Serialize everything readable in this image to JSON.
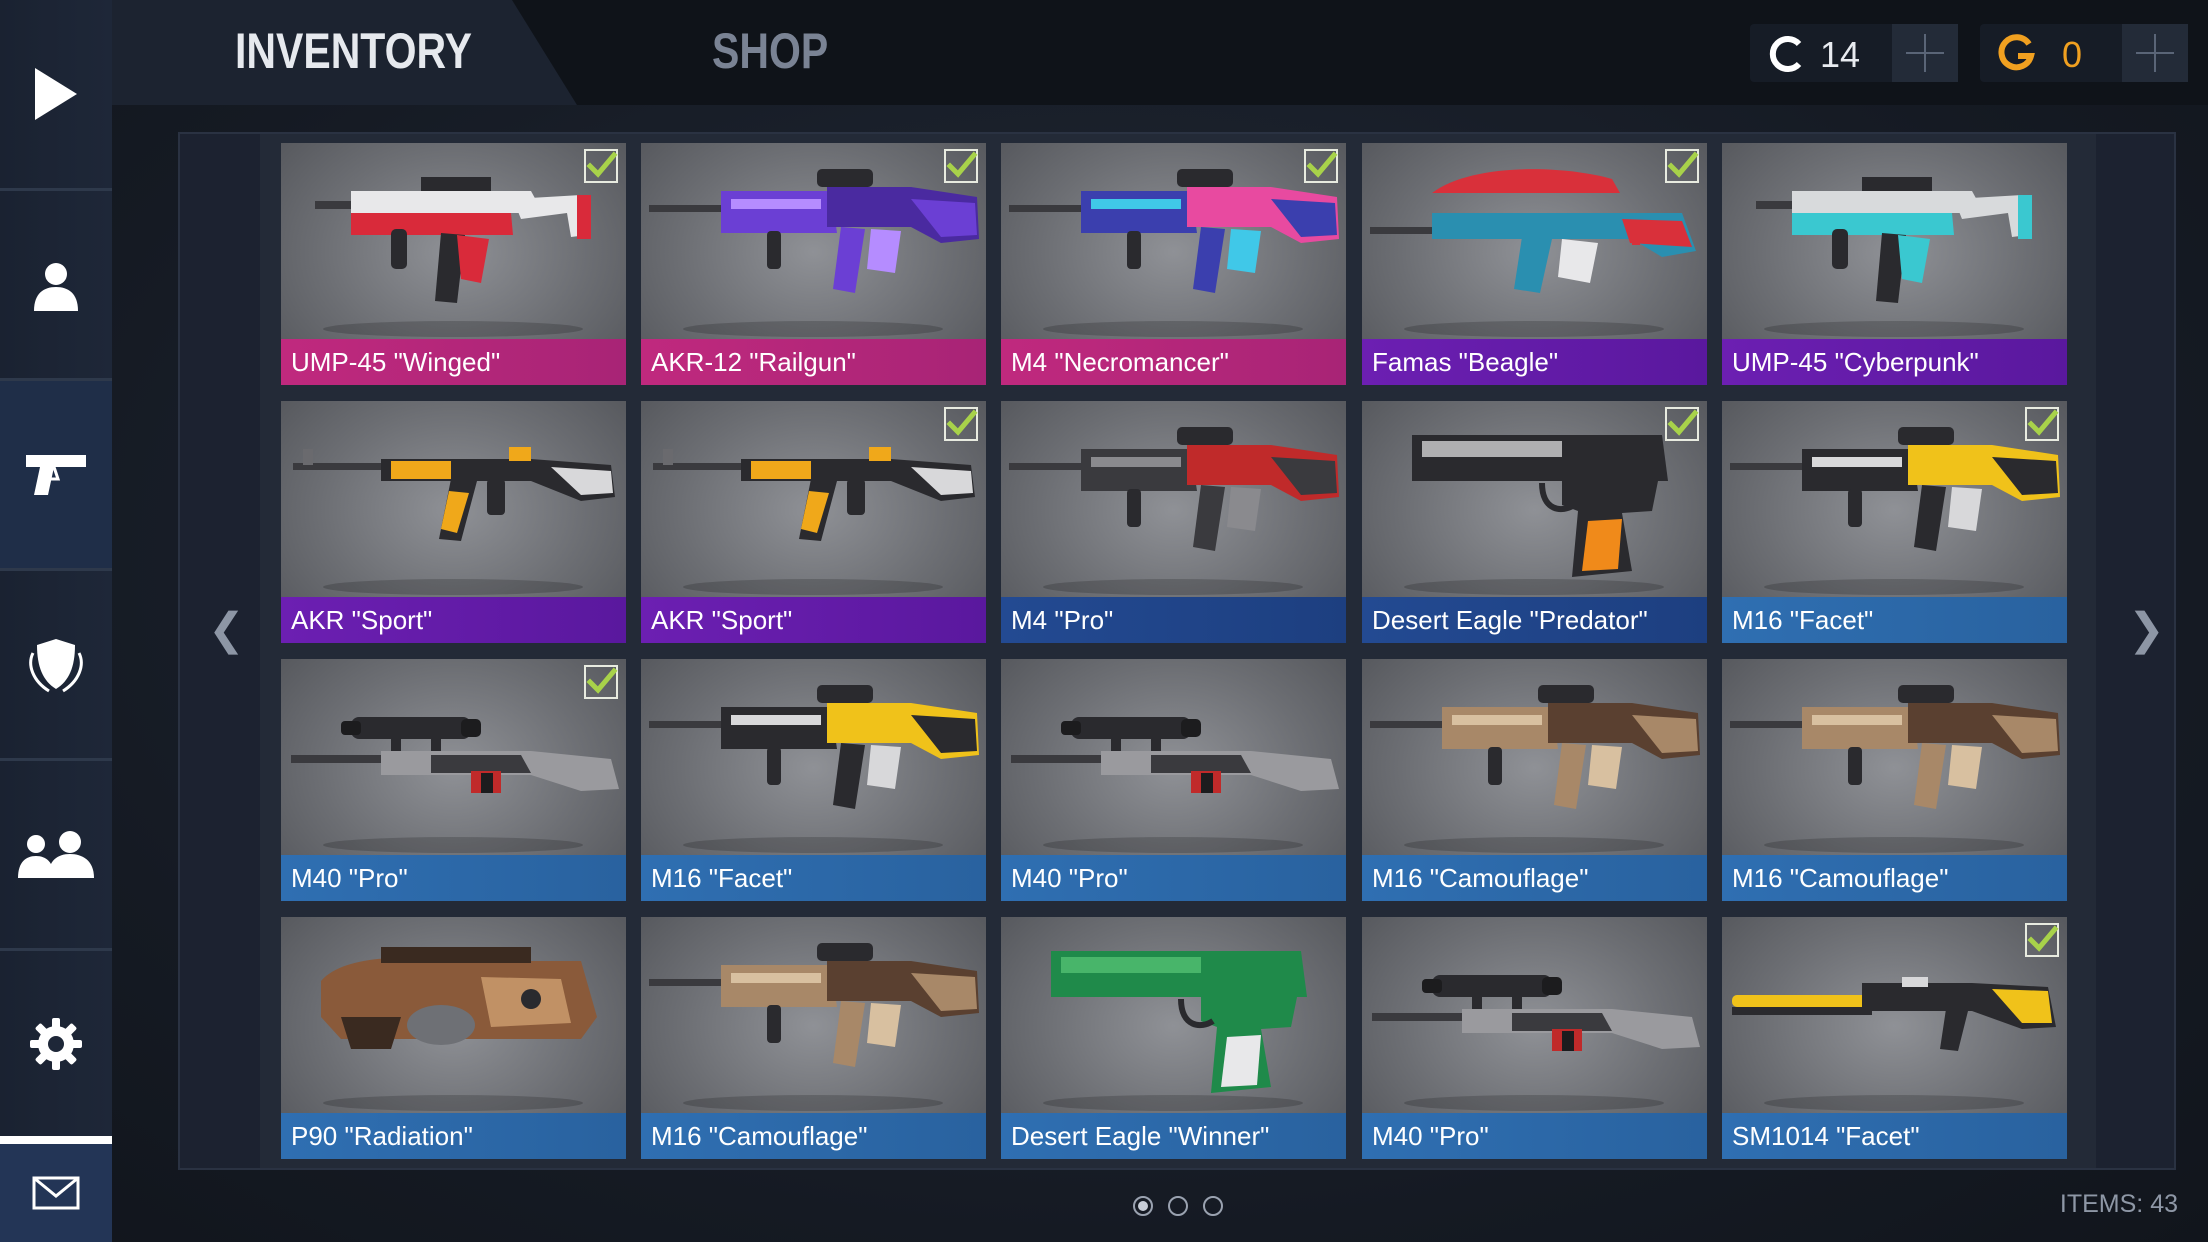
{
  "tabs": {
    "inventory": "INVENTORY",
    "shop": "SHOP"
  },
  "currency": {
    "credits": {
      "icon": "credits-icon",
      "value": "14"
    },
    "gold": {
      "icon": "gold-icon",
      "value": "0"
    }
  },
  "sidebar": {
    "items": [
      {
        "icon": "play-icon"
      },
      {
        "icon": "profile-icon"
      },
      {
        "icon": "pistol-icon",
        "active": true
      },
      {
        "icon": "clan-shield-icon"
      },
      {
        "icon": "friends-icon"
      },
      {
        "icon": "gear-icon"
      },
      {
        "icon": "mail-icon"
      }
    ]
  },
  "colors": {
    "pink": "#c0297e",
    "purple": "#6c1fb2",
    "navy": "#234a92",
    "blue": "#2f6fb2",
    "check": "#a8d24a"
  },
  "inventory": {
    "items": [
      {
        "name": "UMP-45 \"Winged\"",
        "rarity": "pink",
        "equipped": true,
        "weapon": "smg",
        "skin": [
          "#e8e8ea",
          "#d92a3a",
          "#2a2a2e"
        ]
      },
      {
        "name": "AKR-12 \"Railgun\"",
        "rarity": "pink",
        "equipped": true,
        "weapon": "rifle",
        "skin": [
          "#6b3fd4",
          "#4a2aa0",
          "#b58cff"
        ]
      },
      {
        "name": "M4 \"Necromancer\"",
        "rarity": "pink",
        "equipped": true,
        "weapon": "rifle",
        "skin": [
          "#3b3fae",
          "#e84aa0",
          "#40c8e8"
        ]
      },
      {
        "name": "Famas \"Beagle\"",
        "rarity": "purple",
        "equipped": true,
        "weapon": "bullpup",
        "skin": [
          "#2a8fb0",
          "#e8e8ea",
          "#d9303a"
        ]
      },
      {
        "name": "UMP-45 \"Cyberpunk\"",
        "rarity": "purple",
        "equipped": false,
        "weapon": "smg",
        "skin": [
          "#d8dadc",
          "#3ac8d0",
          "#2a2a2e"
        ]
      },
      {
        "name": "AKR \"Sport\"",
        "rarity": "purple",
        "equipped": false,
        "weapon": "ak",
        "skin": [
          "#2a2a2e",
          "#f0a81a",
          "#d8d8da"
        ]
      },
      {
        "name": "AKR \"Sport\"",
        "rarity": "purple",
        "equipped": true,
        "weapon": "ak",
        "skin": [
          "#2a2a2e",
          "#f0a81a",
          "#d8d8da"
        ]
      },
      {
        "name": "M4 \"Pro\"",
        "rarity": "navy",
        "equipped": false,
        "weapon": "rifle",
        "skin": [
          "#3a3a3e",
          "#c02a2a",
          "#8a8a8e"
        ]
      },
      {
        "name": "Desert Eagle \"Predator\"",
        "rarity": "navy",
        "equipped": true,
        "weapon": "pistol",
        "skin": [
          "#2a2a2e",
          "#f08a1a",
          "#e8e8ea"
        ]
      },
      {
        "name": "M16 \"Facet\"",
        "rarity": "blue",
        "equipped": true,
        "weapon": "rifle",
        "skin": [
          "#2a2a2e",
          "#f0c21a",
          "#d8d8da"
        ]
      },
      {
        "name": "M40 \"Pro\"",
        "rarity": "blue",
        "equipped": true,
        "weapon": "sniper",
        "skin": [
          "#3a3a3e",
          "#c02a2a",
          "#9a9a9e"
        ]
      },
      {
        "name": "M16 \"Facet\"",
        "rarity": "blue",
        "equipped": false,
        "weapon": "rifle",
        "skin": [
          "#2a2a2e",
          "#f0c21a",
          "#d8d8da"
        ]
      },
      {
        "name": "M40 \"Pro\"",
        "rarity": "blue",
        "equipped": false,
        "weapon": "sniper",
        "skin": [
          "#3a3a3e",
          "#c02a2a",
          "#9a9a9e"
        ]
      },
      {
        "name": "M16 \"Camouflage\"",
        "rarity": "blue",
        "equipped": false,
        "weapon": "rifle",
        "skin": [
          "#a88868",
          "#5a4030",
          "#d8c0a0"
        ]
      },
      {
        "name": "M16 \"Camouflage\"",
        "rarity": "blue",
        "equipped": false,
        "weapon": "rifle",
        "skin": [
          "#a88868",
          "#5a4030",
          "#d8c0a0"
        ]
      },
      {
        "name": "P90 \"Radiation\"",
        "rarity": "blue",
        "equipped": false,
        "weapon": "p90",
        "skin": [
          "#8a5a3a",
          "#3a2a20",
          "#d8a878"
        ]
      },
      {
        "name": "M16 \"Camouflage\"",
        "rarity": "blue",
        "equipped": false,
        "weapon": "rifle",
        "skin": [
          "#a88868",
          "#5a4030",
          "#d8c0a0"
        ]
      },
      {
        "name": "Desert Eagle \"Winner\"",
        "rarity": "blue",
        "equipped": false,
        "weapon": "pistol",
        "skin": [
          "#1f8a4a",
          "#e8e8ea",
          "#5ac878"
        ]
      },
      {
        "name": "M40 \"Pro\"",
        "rarity": "blue",
        "equipped": false,
        "weapon": "sniper",
        "skin": [
          "#3a3a3e",
          "#c02a2a",
          "#9a9a9e"
        ]
      },
      {
        "name": "SM1014 \"Facet\"",
        "rarity": "blue",
        "equipped": true,
        "weapon": "shotgun",
        "skin": [
          "#2a2a2e",
          "#f0c21a",
          "#d8d8da"
        ]
      }
    ]
  },
  "pagination": {
    "pages": 3,
    "current": 1,
    "prev_icon": "chevron-left-icon",
    "next_icon": "chevron-right-icon",
    "prev_glyph": "❮",
    "next_glyph": "❯"
  },
  "footer": {
    "items_count": "ITEMS: 43"
  }
}
